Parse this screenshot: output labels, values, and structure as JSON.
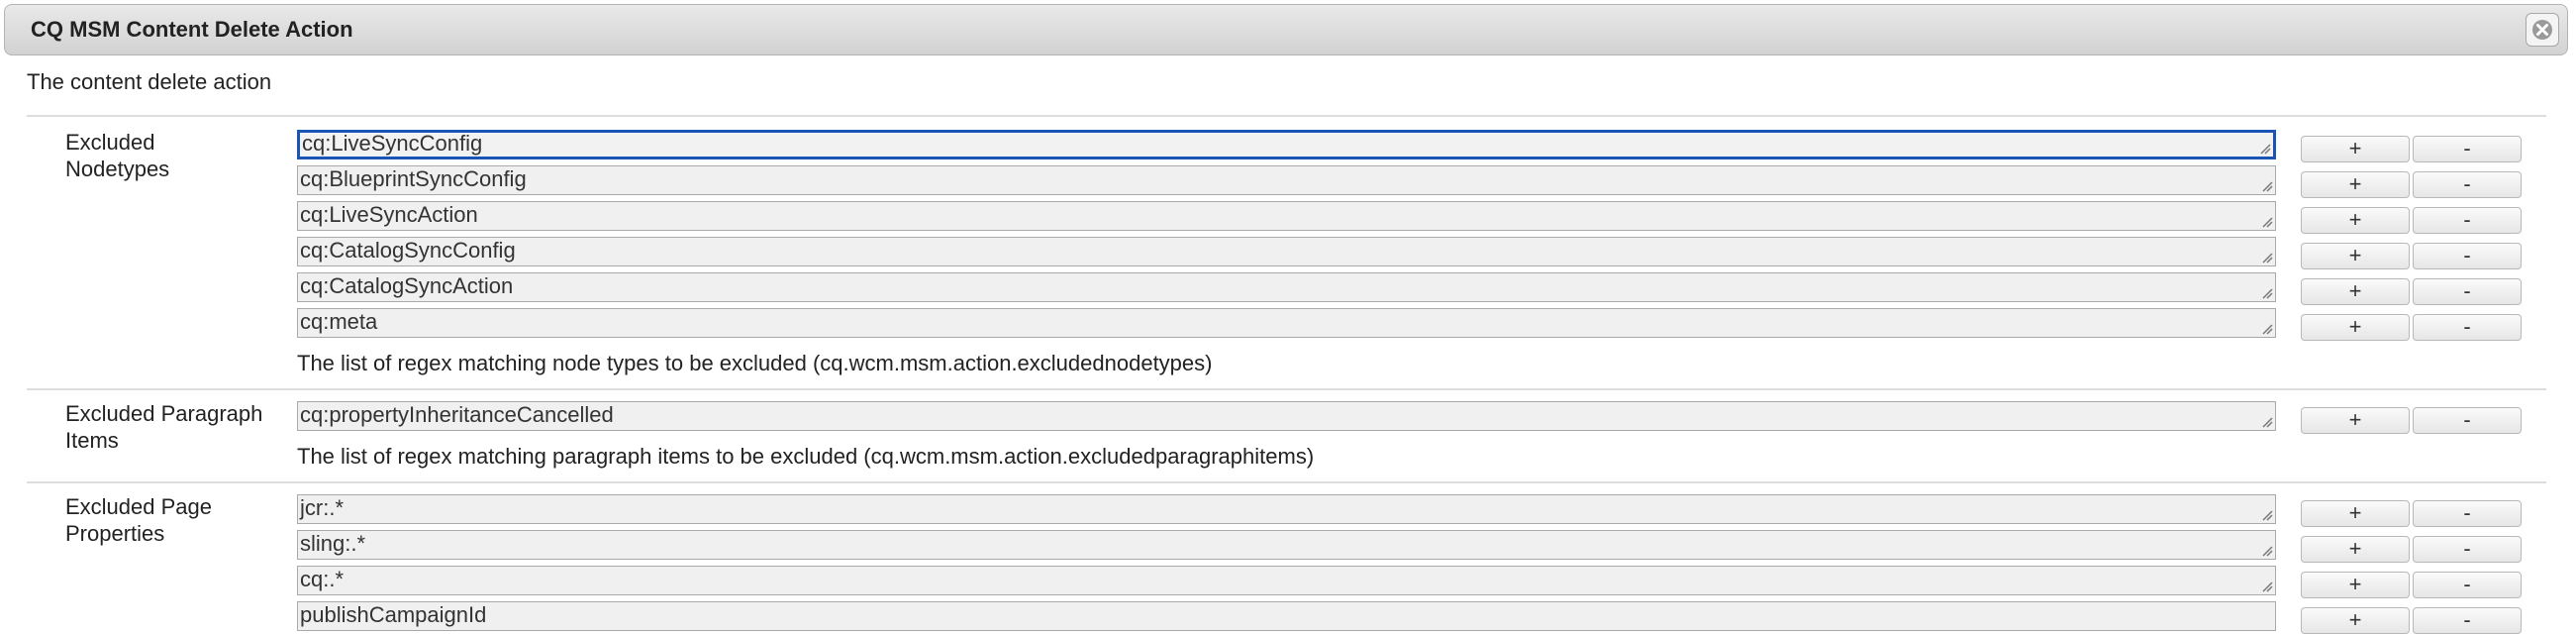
{
  "dialog": {
    "title": "CQ MSM Content Delete Action",
    "description": "The content delete action",
    "close_icon": "close-icon"
  },
  "buttons": {
    "add_label": "+",
    "remove_label": "-"
  },
  "sections": [
    {
      "label": "Excluded Nodetypes",
      "values": [
        "cq:LiveSyncConfig",
        "cq:BlueprintSyncConfig",
        "cq:LiveSyncAction",
        "cq:CatalogSyncConfig",
        "cq:CatalogSyncAction",
        "cq:meta"
      ],
      "hint": "The list of regex matching node types to be excluded (cq.wcm.msm.action.excludednodetypes)"
    },
    {
      "label": "Excluded Paragraph Items",
      "values": [
        "cq:propertyInheritanceCancelled"
      ],
      "hint": "The list of regex matching paragraph items to be excluded (cq.wcm.msm.action.excludedparagraphitems)"
    },
    {
      "label": "Excluded Page Properties",
      "values": [
        "jcr:.*",
        "sling:.*",
        "cq:.*",
        "publishCampaignId"
      ],
      "hint": ""
    }
  ]
}
